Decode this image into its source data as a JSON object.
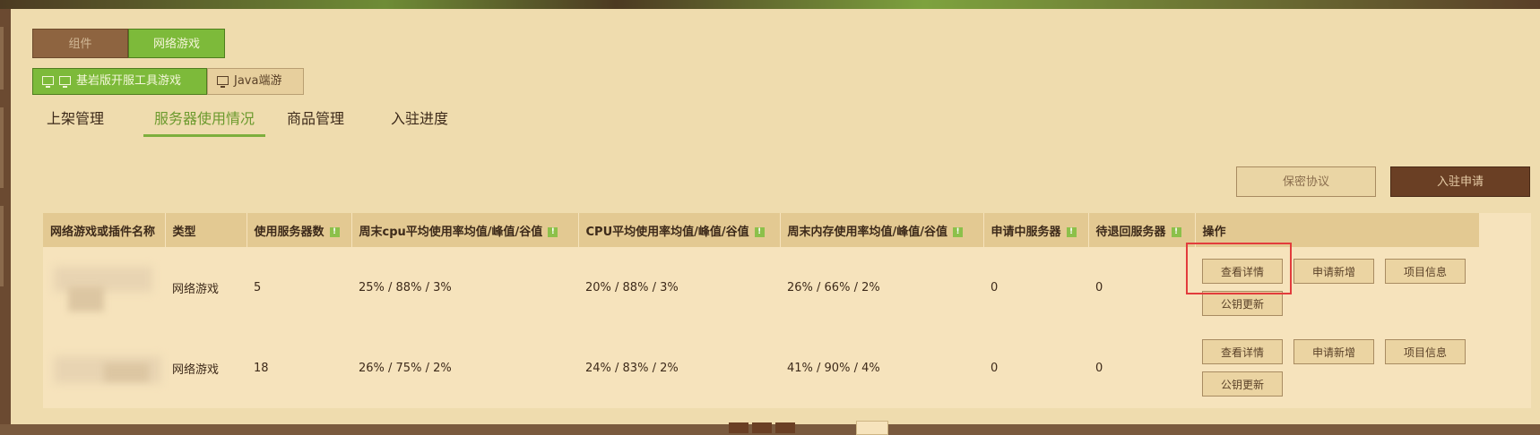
{
  "main_tabs": [
    {
      "label": "组件",
      "active": false
    },
    {
      "label": "网络游戏",
      "active": true
    }
  ],
  "sub_tabs": [
    {
      "label": "基岩版开服工具游戏",
      "icons": [
        "phone-icon",
        "monitor-icon"
      ],
      "active": true
    },
    {
      "label": "Java端游",
      "icons": [
        "monitor-icon"
      ],
      "active": false
    }
  ],
  "nav_tabs": [
    {
      "label": "上架管理"
    },
    {
      "label": "服务器使用情况",
      "active": true
    },
    {
      "label": "商品管理"
    },
    {
      "label": "入驻进度"
    }
  ],
  "actions": {
    "secret_label": "保密协议",
    "apply_label": "入驻申请"
  },
  "table": {
    "headers": [
      "网络游戏或插件名称",
      "类型",
      "使用服务器数",
      "周末cpu平均使用率均值/峰值/谷值",
      "CPU平均使用率均值/峰值/谷值",
      "周末内存使用率均值/峰值/谷值",
      "申请中服务器",
      "待退回服务器",
      "操作"
    ],
    "info_icon_glyph": "!",
    "rows": [
      {
        "name": "",
        "type": "网络游戏",
        "servers": "5",
        "weekend_cpu": "25% / 88% / 3%",
        "cpu": "20% / 88% / 3%",
        "weekend_mem": "26% / 66% / 2%",
        "applying": "0",
        "returning": "0"
      },
      {
        "name": "",
        "type": "网络游戏",
        "servers": "18",
        "weekend_cpu": "26% / 75% / 2%",
        "cpu": "24% / 83% / 2%",
        "weekend_mem": "41% / 90% / 4%",
        "applying": "0",
        "returning": "0"
      }
    ],
    "op_labels": {
      "detail": "查看详情",
      "apply_new": "申请新增",
      "project_info": "项目信息",
      "key_update": "公钥更新"
    }
  },
  "colors": {
    "accent_green": "#7dba3a",
    "panel_bg": "#efdcae",
    "dark_brown": "#6a3f24",
    "highlight_red": "#e23c3c"
  }
}
